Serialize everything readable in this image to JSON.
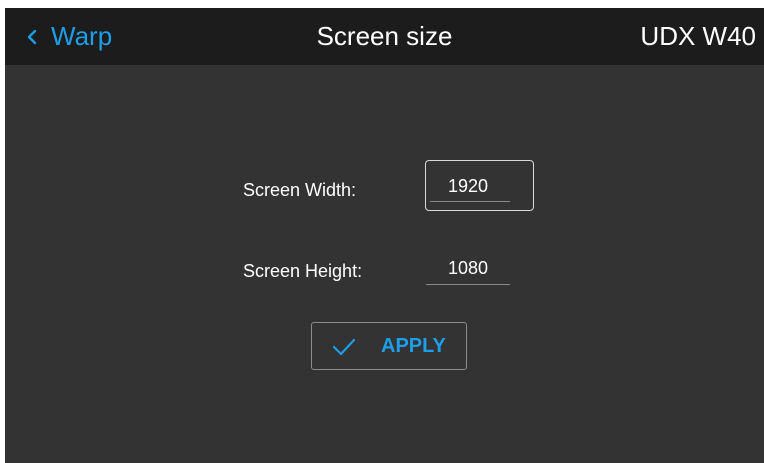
{
  "header": {
    "back_label": "Warp",
    "title": "Screen size",
    "model": "UDX W40"
  },
  "form": {
    "width_label": "Screen Width:",
    "width_value": "1920",
    "height_label": "Screen Height:",
    "height_value": "1080"
  },
  "apply": {
    "label": "APPLY"
  },
  "colors": {
    "accent": "#1d9ee8",
    "background": "#333333",
    "header_bg": "#1c1c1c"
  },
  "icons": {
    "back": "chevron-left-icon",
    "apply": "check-icon"
  }
}
